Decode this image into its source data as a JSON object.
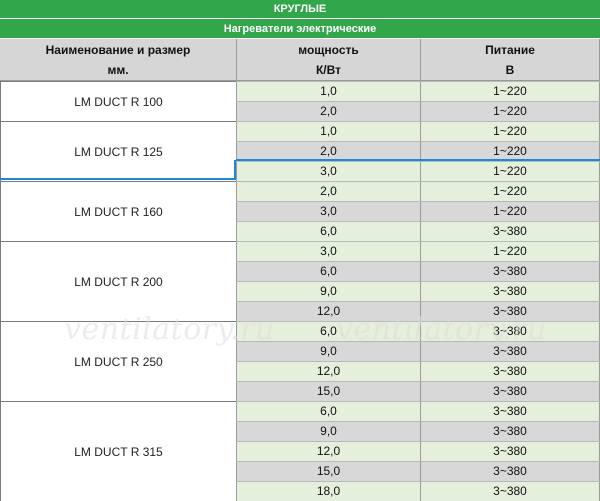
{
  "banner": {
    "title": "КРУГЛЫЕ",
    "subtitle": "Нагреватели электрические"
  },
  "header": {
    "col1_line1": "Наименование и размер",
    "col1_line2": "мм.",
    "col2_line1": "мощность",
    "col2_line2": "К/Вт",
    "col3_line1": "Питание",
    "col3_line2": "В"
  },
  "groups": [
    {
      "name": "LM DUCT R 100",
      "rows": [
        {
          "power": "1,0",
          "supply": "1~220"
        },
        {
          "power": "2,0",
          "supply": "1~220"
        }
      ]
    },
    {
      "name": "LM DUCT R 125",
      "rows": [
        {
          "power": "1,0",
          "supply": "1~220"
        },
        {
          "power": "2,0",
          "supply": "1~220"
        },
        {
          "power": "3,0",
          "supply": "1~220"
        }
      ]
    },
    {
      "name": "LM DUCT R 160",
      "rows": [
        {
          "power": "2,0",
          "supply": "1~220"
        },
        {
          "power": "3,0",
          "supply": "1~220"
        },
        {
          "power": "6,0",
          "supply": "3~380"
        }
      ]
    },
    {
      "name": "LM DUCT R 200",
      "rows": [
        {
          "power": "3,0",
          "supply": "1~220"
        },
        {
          "power": "6,0",
          "supply": "3~380"
        },
        {
          "power": "9,0",
          "supply": "3~380"
        },
        {
          "power": "12,0",
          "supply": "3~380"
        }
      ]
    },
    {
      "name": "LM DUCT R 250",
      "rows": [
        {
          "power": "6,0",
          "supply": "3~380"
        },
        {
          "power": "9,0",
          "supply": "3~380"
        },
        {
          "power": "12,0",
          "supply": "3~380"
        },
        {
          "power": "15,0",
          "supply": "3~380"
        }
      ]
    },
    {
      "name": "LM DUCT R 315",
      "rows": [
        {
          "power": "6,0",
          "supply": "3~380"
        },
        {
          "power": "9,0",
          "supply": "3~380"
        },
        {
          "power": "12,0",
          "supply": "3~380"
        },
        {
          "power": "15,0",
          "supply": "3~380"
        },
        {
          "power": "18,0",
          "supply": "3~380"
        }
      ]
    }
  ],
  "watermark": "ventilatory.ru",
  "colors": {
    "banner": "#31a64a",
    "header": "#d6d6d6",
    "row_green": "#e4efdc",
    "row_gray": "#d8d8d8",
    "selection": "#1f87d6"
  }
}
